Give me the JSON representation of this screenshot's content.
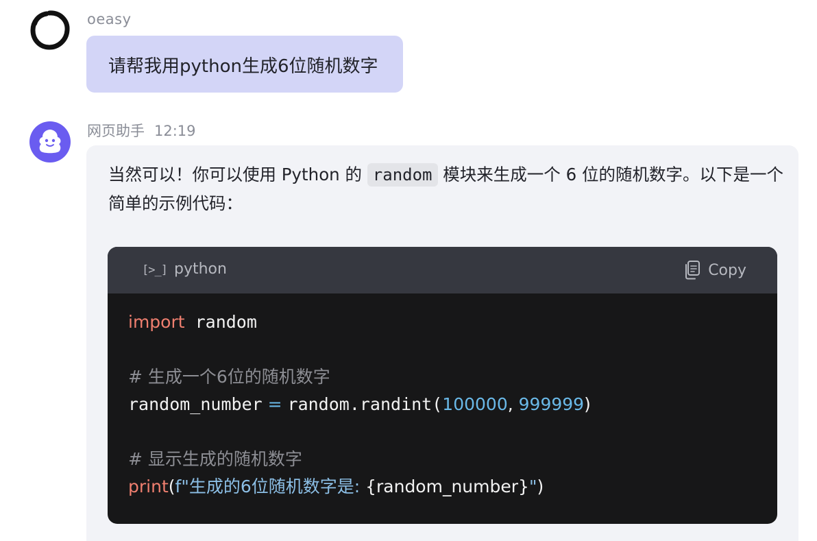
{
  "user_message": {
    "username": "oeasy",
    "text": "请帮我用python生成6位随机数字"
  },
  "assistant_message": {
    "name": "网页助手",
    "time": "12:19",
    "intro_before": "当然可以！你可以使用 Python 的 ",
    "intro_code": "random",
    "intro_after": " 模块来生成一个 6 位的随机数字。以下是一个简单的示例代码：",
    "code_block": {
      "lang_icon": "[>_]",
      "language": "python",
      "copy_label": "Copy",
      "lines": {
        "l1_kw": "import",
        "l1_rest": " random",
        "l3_comment": "# 生成一个6位的随机数字",
        "l4_var": "random_number",
        "l4_op": " = ",
        "l4_call": "random.randint(",
        "l4_n1": "100000",
        "l4_sep": ", ",
        "l4_n2": "999999",
        "l4_close": ")",
        "l6_comment": "# 显示生成的随机数字",
        "l7_fn": "print",
        "l7_open": "(",
        "l7_str": "f\"生成的6位随机数字是: ",
        "l7_expr": "{random_number}",
        "l7_strend": "\"",
        "l7_close": ")"
      }
    }
  },
  "colors": {
    "user_bubble": "#d3d5f7",
    "assistant_bubble": "#f2f3f7",
    "code_bg": "#171718",
    "code_header": "#363840",
    "keyword": "#ef7f6f",
    "number": "#6ab9e8",
    "comment": "#8d8e94",
    "bot_avatar": "#6a5cf0"
  }
}
